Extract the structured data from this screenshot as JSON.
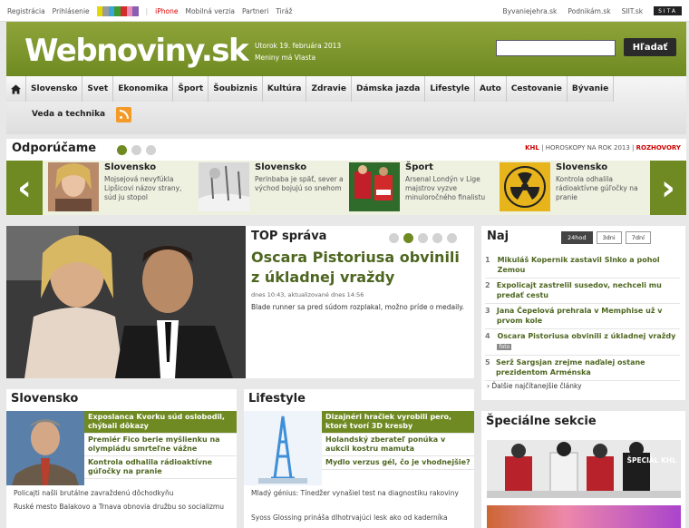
{
  "topbar": {
    "left_links": [
      "Registrácia",
      "Prihlásenie"
    ],
    "iphone": "iPhone",
    "mid_links": [
      "Mobilná verzia",
      "Partneri",
      "Tiráž"
    ],
    "right_links": [
      "Byvaniejehra.sk",
      "Podnikám.sk",
      "SIIT.sk"
    ],
    "sita": "SITA",
    "colorbar": [
      "#e4d900",
      "#9a9a9a",
      "#3aa5d8",
      "#3e9a2e",
      "#d22d2d",
      "#e88bb8",
      "#8a5fb1"
    ]
  },
  "header": {
    "logo": "Webnoviny.sk",
    "date": "Utorok 19. februára 2013",
    "nameday": "Meniny má Vlasta",
    "search_button": "Hľadať"
  },
  "nav": {
    "items": [
      "Slovensko",
      "Svet",
      "Ekonomika",
      "Šport",
      "Šoubiznis",
      "Kultúra",
      "Zdravie",
      "Dámska jazda",
      "Lifestyle",
      "Auto",
      "Cestovanie",
      "Bývanie"
    ],
    "row2": "Veda a technika"
  },
  "recommend": {
    "title": "Odporúčame",
    "links": {
      "khl": "KHL",
      "horoskopy": "HOROSKOPY NA ROK 2013",
      "rozhovory": "ROZHOVORY"
    },
    "items": [
      {
        "category": "Slovensko",
        "text": "Mojsejová nevyfúkla Lipšicovi názov strany, súd ju stopol"
      },
      {
        "category": "Slovensko",
        "text": "Perinbaba je späť, sever a východ bojujú so snehom"
      },
      {
        "category": "Šport",
        "text": "Arsenal Londýn v Lige majstrov vyzve minuloročného finalistu"
      },
      {
        "category": "Slovensko",
        "text": "Kontrola odhalila rádioaktívne gúľočky na pranie"
      }
    ]
  },
  "top": {
    "label": "TOP správa",
    "headline": "Oscara Pistoriusa obvinili z úkladnej vraždy",
    "meta": "dnes 10:43, aktualizované dnes 14:56",
    "lead": "Blade runner sa pred súdom rozplakal, možno príde o medaily."
  },
  "naj": {
    "title": "Naj",
    "tabs": [
      "24hod",
      "3dni",
      "7dní"
    ],
    "items": [
      {
        "n": "1",
        "text": "Mikuláš Kopernik zastavil Slnko a pohol Zemou"
      },
      {
        "n": "2",
        "text": "Expolicajt zastrelil susedov, nechceli mu predať cestu"
      },
      {
        "n": "3",
        "text": "Jana Čepelová prehrala v Memphise už v prvom kole"
      },
      {
        "n": "4",
        "text": "Oscara Pistoriusa obvinili z úkladnej vraždy",
        "badge": "foto"
      },
      {
        "n": "5",
        "text": "Serž Sargsjan zrejme naďalej ostane prezidentom Arménska"
      }
    ],
    "more": "Ďalšie najčítanejšie články"
  },
  "slovensko": {
    "title": "Slovensko",
    "items": [
      "Exposlanca Kvorku súd oslobodil, chýbali dôkazy",
      "Premiér Fico berie myšlienku na olympiádu smrteľne vážne",
      "Kontrola odhalila rádioaktívne gúľočky na pranie"
    ],
    "small": [
      "Policajti našli brutálne zavraždenú dôchodkyňu",
      "Ruské mesto Balakovo a Trnava obnovia družbu so socializmu"
    ]
  },
  "lifestyle": {
    "title": "Lifestyle",
    "items": [
      "Dizajnéri hračiek vyrobili pero, ktoré tvorí 3D kresby",
      "Holandský zberateľ ponúka v aukcii kostru mamuta",
      "Mydlo verzus gél, čo je vhodnejšie?"
    ],
    "small": [
      "Mladý génius: Tínedžer vynašiel test na diagnostiku rakoviny",
      "Syoss Glossing prináša dlhotrvajúci lesk ako od kaderníka"
    ]
  },
  "special": {
    "title": "Špeciálne sekcie",
    "khl": "ŠPECIÁL KHL"
  }
}
